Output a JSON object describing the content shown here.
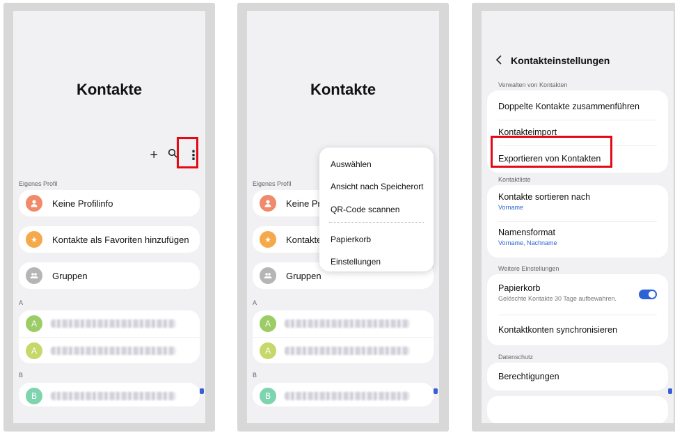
{
  "screen1": {
    "title": "Kontakte",
    "toolbar": {
      "add_icon": "+",
      "search_icon": "⚲",
      "menu_icon": "⋮"
    },
    "own_profile_label": "Eigenes Profil",
    "profile_item": "Keine Profilinfo",
    "favorites_item": "Kontakte als Favoriten hinzufügen",
    "groups_item": "Gruppen",
    "section_a": "A",
    "section_b": "B",
    "contacts_a": [
      "A",
      "A"
    ],
    "contacts_b": [
      "B"
    ]
  },
  "screen2": {
    "title": "Kontakte",
    "own_profile_label": "Eigenes Profil",
    "profile_item": "Keine Pr",
    "favorites_item": "Kontakte",
    "groups_item": "Gruppen",
    "section_a": "A",
    "section_b": "B",
    "contacts_a": [
      "A",
      "A"
    ],
    "contacts_b": [
      "B"
    ],
    "menu": {
      "select": "Auswählen",
      "view_by_storage": "Ansicht nach Speicherort",
      "qr_scan": "QR-Code scannen",
      "trash": "Papierkorb",
      "settings": "Einstellungen"
    }
  },
  "screen3": {
    "title": "Kontakteinstellungen",
    "back_icon": "‹",
    "manage_section": "Verwalten von Kontakten",
    "merge_duplicates": "Doppelte Kontakte zusammenführen",
    "import": "Kontakteimport",
    "export": "Exportieren von Kontakten",
    "list_section": "Kontaktliste",
    "sort_by": "Kontakte sortieren nach",
    "sort_by_value": "Vorname",
    "name_format": "Namensformat",
    "name_format_value": "Vorname, Nachname",
    "more_section": "Weitere Einstellungen",
    "trash": "Papierkorb",
    "trash_desc": "Gelöschte Kontakte 30 Tage aufbewahren.",
    "trash_toggle": true,
    "sync": "Kontaktkonten synchronisieren",
    "privacy_section": "Datenschutz",
    "permissions": "Berechtigungen"
  },
  "colors": {
    "highlight": "#e50914",
    "accent": "#2c63d4",
    "avatar_profile": "#f08a6a",
    "avatar_favorite": "#f5a94a",
    "avatar_groups": "#b5b5b5",
    "avatar_a": "#9ccc65",
    "avatar_b": "#7fd4b0"
  }
}
